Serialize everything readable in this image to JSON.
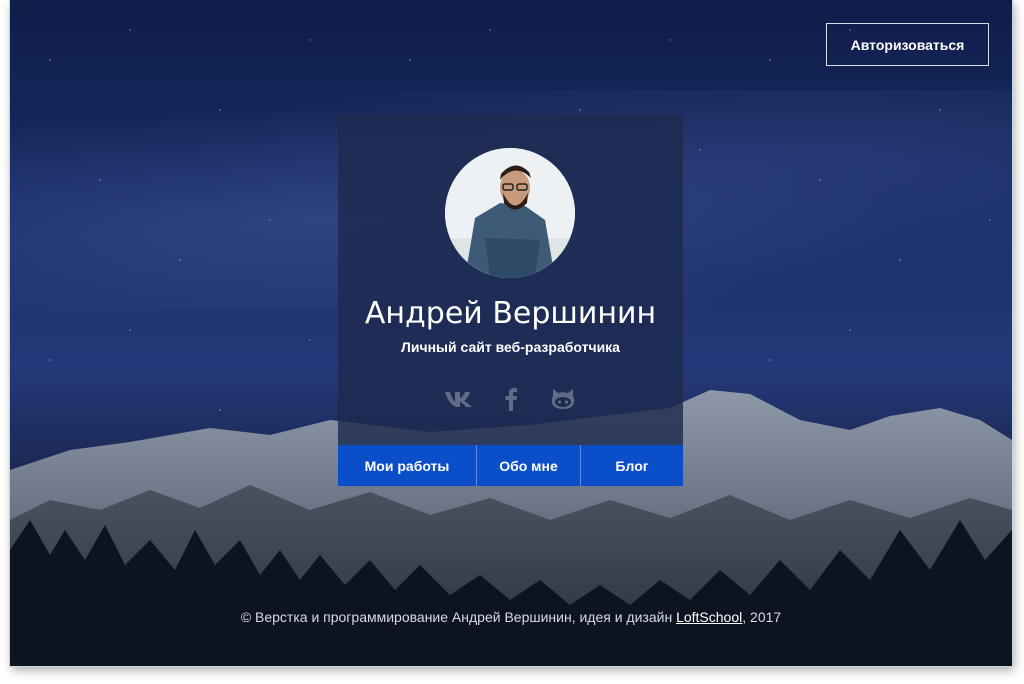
{
  "header": {
    "auth_label": "Авторизоваться"
  },
  "profile": {
    "name": "Андрей Вершинин",
    "subtitle": "Личный сайт веб-разработчика",
    "socials": [
      {
        "icon": "vk-icon"
      },
      {
        "icon": "facebook-icon"
      },
      {
        "icon": "github-icon"
      }
    ]
  },
  "nav": {
    "items": [
      {
        "label": "Мои работы"
      },
      {
        "label": "Обо мне"
      },
      {
        "label": "Блог"
      }
    ]
  },
  "footer": {
    "prefix": "© Верстка и программирование Андрей Вершинин, идея и дизайн ",
    "link": "LoftSchool",
    "suffix": ", 2017"
  },
  "colors": {
    "nav_bg": "#0a4fc9",
    "card_bg": "#1d2b4e",
    "sky": "#1b2f6a"
  }
}
